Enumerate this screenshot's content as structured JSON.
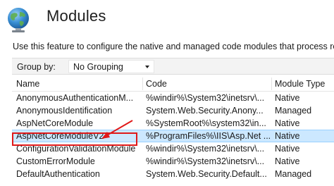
{
  "header": {
    "title": "Modules",
    "description": "Use this feature to configure the native and managed code modules that process req"
  },
  "toolbar": {
    "groupby_label": "Group by:",
    "groupby_value": "No Grouping"
  },
  "table": {
    "columns": [
      "Name",
      "Code",
      "Module Type"
    ],
    "rows": [
      {
        "name": "AnonymousAuthenticationM...",
        "code": "%windir%\\System32\\inetsrv\\...",
        "type": "Native"
      },
      {
        "name": "AnonymousIdentification",
        "code": "System.Web.Security.Anony...",
        "type": "Managed"
      },
      {
        "name": "AspNetCoreModule",
        "code": "%SystemRoot%\\system32\\in...",
        "type": "Native"
      },
      {
        "name": "AspNetCoreModuleV2",
        "code": "%ProgramFiles%\\IIS\\Asp.Net ...",
        "type": "Native"
      },
      {
        "name": "ConfigurationValidationModule",
        "code": "%windir%\\System32\\inetsrv\\...",
        "type": "Native"
      },
      {
        "name": "CustomErrorModule",
        "code": "%windir%\\System32\\inetsrv\\...",
        "type": "Native"
      },
      {
        "name": "DefaultAuthentication",
        "code": "System.Web.Security.Default...",
        "type": "Managed"
      }
    ],
    "selected_row": "AspNetCoreModuleV2"
  },
  "colors": {
    "selection_background": "#cce8ff",
    "selection_border": "#99d1ff",
    "callout": "#e01919"
  },
  "icons": {
    "header": "globe-icon",
    "dropdown": "chevron-down-icon"
  }
}
